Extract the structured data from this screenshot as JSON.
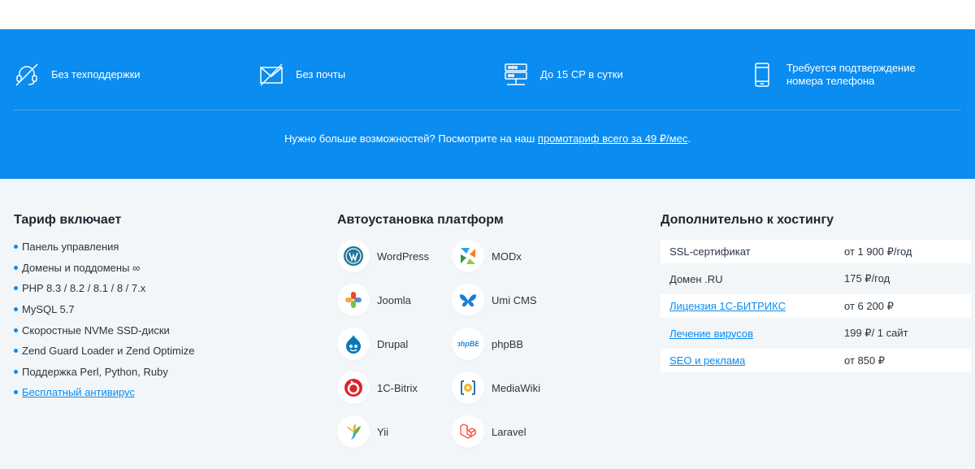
{
  "features": [
    {
      "icon": "no-support-icon",
      "text": "Без техподдержки"
    },
    {
      "icon": "no-mail-icon",
      "text": "Без почты"
    },
    {
      "icon": "server-icon",
      "text": "До 15 CP в сутки"
    },
    {
      "icon": "phone-icon",
      "text_line1": "Требуется подтверждение",
      "text_line2": "номера телефона"
    }
  ],
  "promo": {
    "text": "Нужно больше возможностей? Посмотрите на наш ",
    "link": "промотариф всего за 49 ₽/мес",
    "suffix": "."
  },
  "tariff": {
    "title": "Тариф включает",
    "items": [
      "Панель управления",
      "Домены и поддомены ∞",
      "PHP 8.3 / 8.2 / 8.1 / 8 / 7.x",
      "MySQL 5.7",
      "Скоростные NVMe SSD-диски",
      "Zend Guard Loader и Zend Optimize",
      "Поддержка Perl, Python, Ruby",
      "Бесплатный антивирус"
    ]
  },
  "platforms": {
    "title": "Автоустановка платформ",
    "items": [
      {
        "name": "WordPress",
        "icon": "wordpress-icon",
        "color": "#21759b"
      },
      {
        "name": "MODx",
        "icon": "modx-icon",
        "color": "#2f9a41"
      },
      {
        "name": "Joomla",
        "icon": "joomla-icon",
        "color": "#f44321"
      },
      {
        "name": "Umi CMS",
        "icon": "umi-cms-icon",
        "color": "#1a7fd6"
      },
      {
        "name": "Drupal",
        "icon": "drupal-icon",
        "color": "#0678be"
      },
      {
        "name": "phpBB",
        "icon": "phpbb-icon",
        "color": "#1f8bd4"
      },
      {
        "name": "1C-Bitrix",
        "icon": "bitrix-icon",
        "color": "#d9252a"
      },
      {
        "name": "MediaWiki",
        "icon": "mediawiki-icon",
        "color": "#f6b51b"
      },
      {
        "name": "Yii",
        "icon": "yii-icon",
        "color": "#1fa3d9"
      },
      {
        "name": "Laravel",
        "icon": "laravel-icon",
        "color": "#f4553d"
      }
    ]
  },
  "addons": {
    "title": "Дополнительно к хостингу",
    "items": [
      {
        "name": "SSL-сертификат",
        "price": "от 1 900 ₽/год",
        "link": false
      },
      {
        "name": "Домен .RU",
        "price": "175 ₽/год",
        "link": false
      },
      {
        "name": "Лицензия 1С-БИТРИКС",
        "price": "от 6 200 ₽",
        "link": true
      },
      {
        "name": "Лечение вирусов",
        "price": "199 ₽/ 1 сайт",
        "link": true
      },
      {
        "name": "SEO и реклама",
        "price": "от 850 ₽",
        "link": true
      }
    ]
  }
}
